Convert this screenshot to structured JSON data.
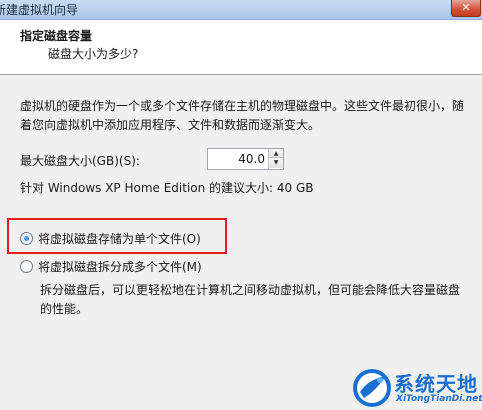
{
  "window": {
    "title": "新建虚拟机向导",
    "close_glyph": "✕"
  },
  "header": {
    "title": "指定磁盘容量",
    "subtitle": "磁盘大小为多少?"
  },
  "main": {
    "description": "虚拟机的硬盘作为一个或多个文件存储在主机的物理磁盘中。这些文件最初很小，随着您向虚拟机中添加应用程序、文件和数据而逐渐变大。",
    "max_size_label": "最大磁盘大小(GB)(S):",
    "max_size_value": "40.0",
    "recommended_text": "针对 Windows XP Home Edition 的建议大小: 40 GB",
    "option_single": {
      "label": "将虚拟磁盘存储为单个文件(O)",
      "checked": true
    },
    "option_multiple": {
      "label": "将虚拟磁盘拆分成多个文件(M)",
      "checked": false,
      "description": "拆分磁盘后，可以更轻松地在计算机之间移动虚拟机，但可能会降低大容量磁盘的性能。"
    }
  },
  "watermark": {
    "name": "系统天地",
    "url": "XiTongTianDi.net"
  },
  "colors": {
    "highlight_border": "#e02020",
    "watermark": "#1a6fd0"
  }
}
